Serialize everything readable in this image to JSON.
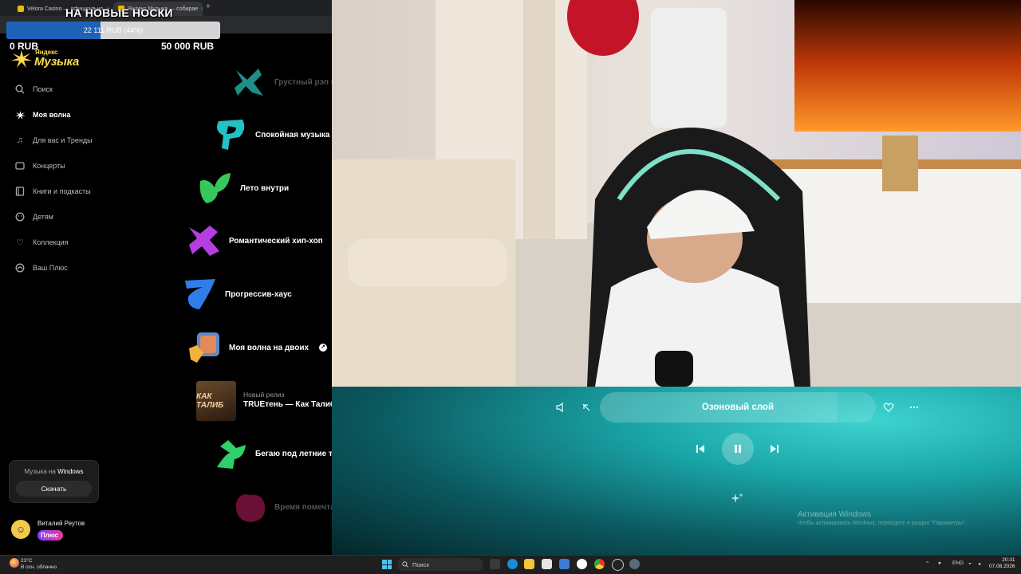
{
  "browser": {
    "tabs": [
      {
        "title": "Velora Casino — официально",
        "close": "×"
      },
      {
        "title": "Яндекс Музыка — собирае",
        "close": "×"
      }
    ],
    "new_tab": "+"
  },
  "donation_goal": {
    "title": "НА НОВЫЕ НОСКИ",
    "progress_text": "22 111 RUB (44%)",
    "progress_fraction": 0.44,
    "min_label": "0 RUB",
    "max_label": "50 000 RUB"
  },
  "logo": {
    "small": "Яндекс",
    "big": "Музыка"
  },
  "sidebar": {
    "items": [
      {
        "label": "Поиск",
        "icon": "search-icon"
      },
      {
        "label": "Моя волна",
        "icon": "wave-star-icon"
      },
      {
        "label": "Для вас и Тренды",
        "icon": "music-note-icon"
      },
      {
        "label": "Концерты",
        "icon": "ticket-icon"
      },
      {
        "label": "Книги и подкасты",
        "icon": "book-icon"
      },
      {
        "label": "Детям",
        "icon": "kids-icon"
      },
      {
        "label": "Коллекция",
        "icon": "heart-icon"
      },
      {
        "label": "Ваш Плюс",
        "icon": "plus-icon"
      }
    ],
    "promo": {
      "text_prefix": "Музыка на ",
      "text_bold": "Windows",
      "button": "Скачать"
    },
    "user": {
      "name": "Виталий Реутов",
      "badge": "Плюс"
    }
  },
  "wave_list": [
    {
      "label": "Грустный рэп и",
      "color": "#1d8f86"
    },
    {
      "label": "Спокойная музыка и",
      "color": "#22c1c3"
    },
    {
      "label": "Лето внутри",
      "color": "#36c85a"
    },
    {
      "label": "Романтический хип-хоп",
      "color": "#b43ee0"
    },
    {
      "label": "Прогрессив-хаус",
      "color": "#2f7de8"
    },
    {
      "label": "Моя волна на двоих",
      "color": "#f0b23a"
    },
    {
      "label": "Бегаю под летние треки",
      "color": "#2fcf6a"
    },
    {
      "label": "Время помечтать",
      "color": "#b01f60"
    }
  ],
  "new_release": {
    "label": "Новый релиз",
    "title": "TRUEтень — Как Талиб",
    "cover_text": "КАК ТАЛИБ"
  },
  "player": {
    "track": "Озоновый слой",
    "progress_fraction": 0.86
  },
  "windows_watermark": {
    "title": "Активация Windows",
    "subtitle": "Чтобы активировать Windows, перейдите в раздел \"Параметры\"."
  },
  "taskbar": {
    "weather_temp": "23°C",
    "weather_desc": "В осн. облачно",
    "search_placeholder": "Поиск",
    "lang": "ENG",
    "time": "20:31",
    "date": "07.08.2026"
  }
}
